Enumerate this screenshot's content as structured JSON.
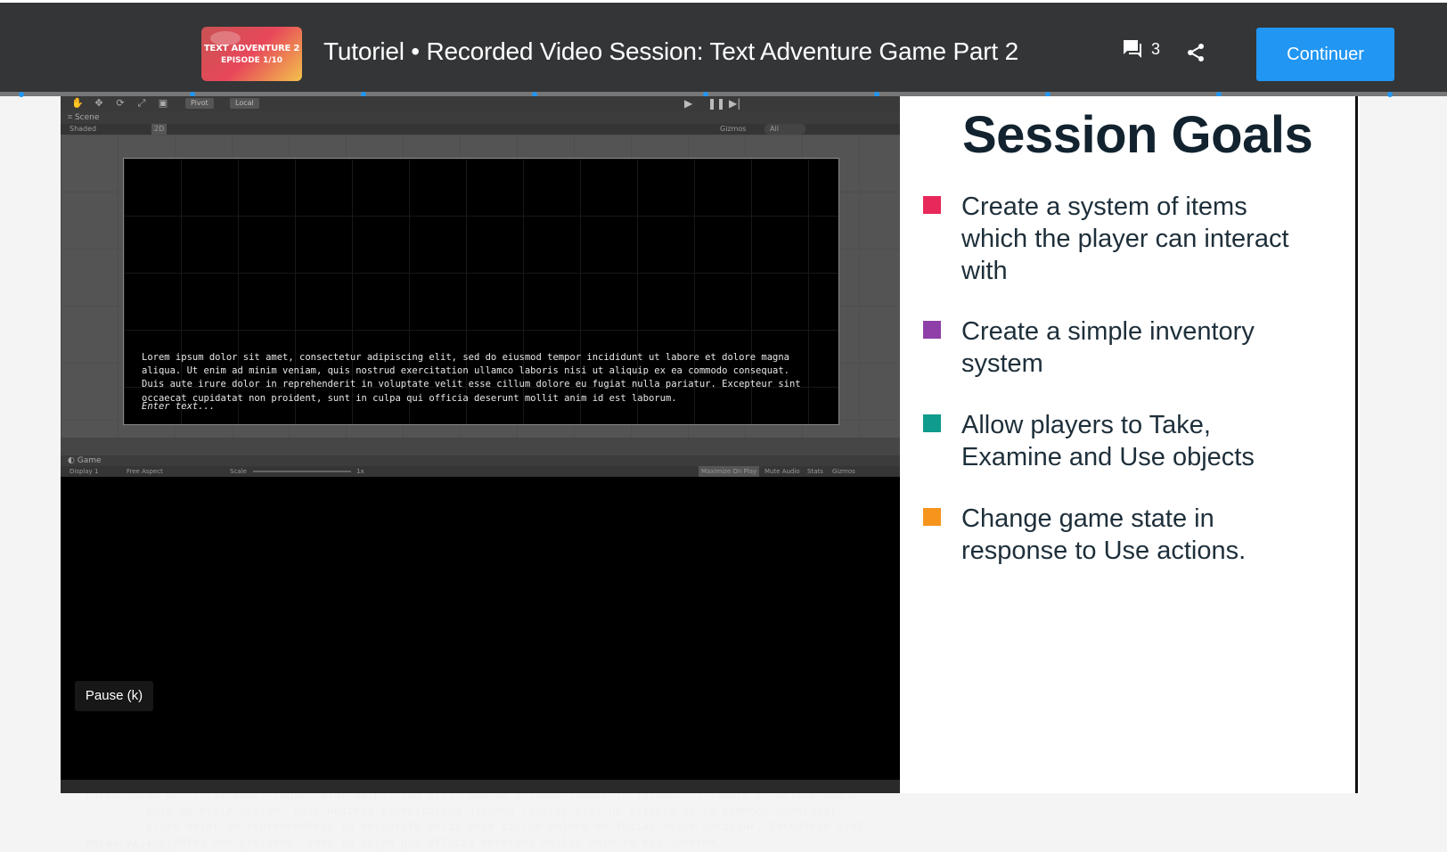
{
  "header": {
    "thumbnail": {
      "line1": "TEXT ADVENTURE 2",
      "line2": "EPISODE 1/10"
    },
    "title": "Tutoriel • Recorded Video Session: Text Adventure Game Part 2",
    "comment_count": "3",
    "continue_label": "Continuer",
    "progress_color": "#2196f3",
    "progress_dots": 9
  },
  "unity": {
    "pivot_label": "Pivot",
    "local_label": "Local",
    "scene_tab": "Scene",
    "scene_shading": "Shaded",
    "scene_2d": "2D",
    "gizmos_label": "Gizmos",
    "all_label": "All",
    "game_tab": "Game",
    "display_label": "Display 1",
    "aspect_label": "Free Aspect",
    "scale_label": "Scale",
    "scale_value": "1x",
    "maximize_label": "Maximize On Play",
    "mute_label": "Mute Audio",
    "stats_label": "Stats",
    "game_gizmos_label": "Gizmos",
    "scene_text": "Lorem ipsum dolor sit amet, consectetur adipiscing elit, sed do eiusmod tempor incididunt ut labore et dolore magna\naliqua. Ut enim ad minim veniam, quis nostrud exercitation ullamco laboris nisi ut aliquip ex ea commodo consequat.\nDuis aute irure dolor in reprehenderit in voluptate velit esse cillum dolore eu fugiat nulla pariatur. Excepteur sint\noccaecat cupidatat non proident, sunt in culpa qui officia deserunt mollit anim id est laborum.",
    "scene_prompt": "Enter text...",
    "game_text": "Lorem ipsum dolor sit amet, consectetur adipiscing elit, sed do eiusmod tempor incididunt ut labore et dolore magna\n         enim ad minim veniam, quis nostrud exercitation ullamco laboris nisi ut aliquip ex ea commodo consequat.\n         irure dolor in reprehenderit in voluptate velit esse cillum dolore eu fugiat nulla pariatur. Excepteur sint\noccaecat cupidatat non proident, sunt in culpa qui officia deserunt mollit anim id est laborum.",
    "game_prompt": "Enter text...",
    "pause_tooltip": "Pause (k)"
  },
  "slide": {
    "title": "Session Goals",
    "goals": [
      {
        "text": "Create a system of items which the player can interact with",
        "color": "#e8285a"
      },
      {
        "text": "Create a simple inventory system",
        "color": "#8e3fa8"
      },
      {
        "text": "Allow players to Take, Examine and Use objects",
        "color": "#0f9b8e"
      },
      {
        "text": "Change game state in response to Use actions.",
        "color": "#f7941d"
      }
    ]
  }
}
